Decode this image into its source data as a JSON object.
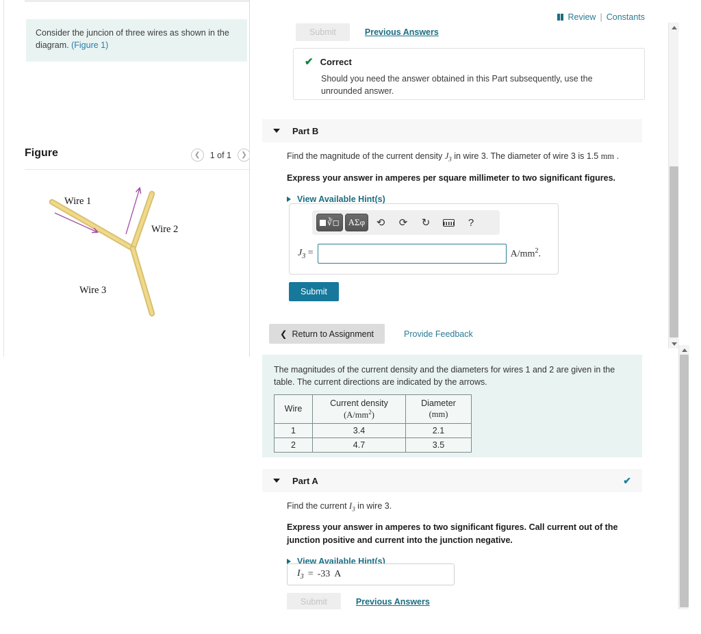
{
  "left_pane": {
    "problem_statement": "Consider the juncion of three wires as shown in the diagram. ",
    "figure_link": "(Figure 1)",
    "figure_title": "Figure",
    "figure_count": "1 of 1",
    "nav_prev_icon": "chevron-left-icon",
    "nav_next_icon": "chevron-right-icon",
    "diagram": {
      "wire1_label": "Wire 1",
      "wire2_label": "Wire 2",
      "wire3_label": "Wire 3",
      "wire_color": "#e3c55c",
      "arrow_color": "#a347a3"
    }
  },
  "review_bar": {
    "icon": "book-icon",
    "review_label": "Review",
    "separator": "|",
    "constants_label": "Constants"
  },
  "part_b_top": {
    "submit_label": "Submit",
    "previous_answers_label": "Previous Answers",
    "feedback": {
      "check_icon": "check-icon",
      "status": "Correct",
      "message": "Should you need the answer obtained in this Part subsequently, use the unrounded answer."
    }
  },
  "part_b": {
    "header_label": "Part B",
    "caret_icon": "caret-down-icon",
    "question_prefix": "Find the magnitude of the current density ",
    "question_var": "J",
    "question_sub": "3",
    "question_mid": " in wire 3. The diameter of wire 3 is 1.5 ",
    "question_unit": "mm",
    "question_suffix": " .",
    "instruction": "Express your answer in amperes per square millimeter to two significant figures.",
    "hints_label": "View Available Hint(s)",
    "toolbar": {
      "math_button": "square-root-icon",
      "greek_button": "ΑΣφ",
      "undo_icon": "undo-icon",
      "redo_icon": "redo-icon",
      "reset_icon": "reset-icon",
      "keyboard_icon": "keyboard-icon",
      "help_icon": "?"
    },
    "answer": {
      "label_var": "J",
      "label_sub": "3",
      "equals": "=",
      "value": "",
      "placeholder": "",
      "units": "A/mm",
      "units_sup": "2",
      "units_trail": "."
    },
    "submit_label": "Submit"
  },
  "footer_actions": {
    "return_icon": "chevron-left-icon",
    "return_label": "Return to Assignment",
    "feedback_label": "Provide Feedback"
  },
  "table_block": {
    "intro": "The magnitudes of the current density and the diameters for wires 1 and 2 are given in the table. The current directions are indicated by the arrows.",
    "headers": [
      "Wire",
      "Current density",
      "Diameter"
    ],
    "header_units": [
      "",
      "(A/mm2)",
      "(mm)"
    ],
    "rows": [
      {
        "wire": "1",
        "current_density": "3.4",
        "diameter": "2.1"
      },
      {
        "wire": "2",
        "current_density": "4.7",
        "diameter": "3.5"
      }
    ]
  },
  "part_a": {
    "header_label": "Part A",
    "caret_icon": "caret-down-icon",
    "status_icon": "check-icon",
    "question_prefix": "Find the current ",
    "question_var": "I",
    "question_sub": "3",
    "question_suffix": " in wire 3.",
    "instruction": "Express your answer in amperes to two significant figures. Call current out of the junction positive and current into the junction negative.",
    "hints_label": "View Available Hint(s)",
    "answer": {
      "label_var": "I",
      "label_sub": "3",
      "equals": "=",
      "value": "-33",
      "units": "A"
    },
    "submit_label": "Submit",
    "previous_answers_label": "Previous Answers"
  },
  "colors": {
    "accent_teal": "#16789a",
    "link_teal": "#1b6d82",
    "info_bg": "#e9f4f2",
    "correct_green": "#14813f",
    "part_header_bg": "#f7f7f7"
  }
}
